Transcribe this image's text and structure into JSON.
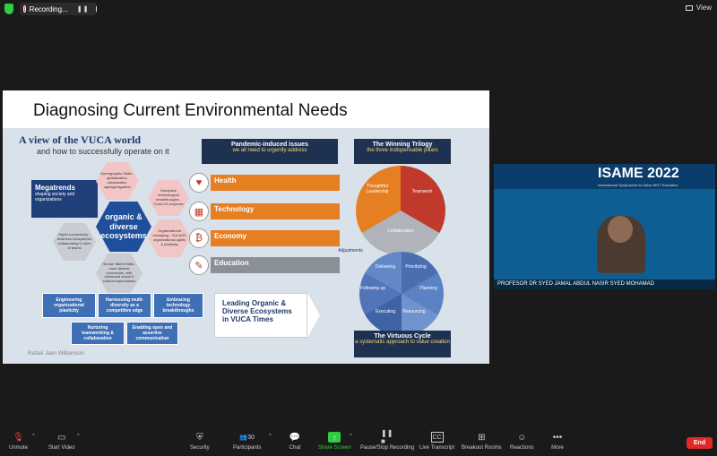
{
  "top_bar": {
    "recording_label": "Recording...",
    "view_label": "View"
  },
  "slide": {
    "title": "Diagnosing Current Environmental Needs",
    "vuca_title": "A view of the VUCA world",
    "vuca_sub": "and how to successfully operate on it",
    "megatrends_title": "Megatrends",
    "megatrends_sub": "shaping society and organizations",
    "center_hex": "organic & diverse ecosystems",
    "hexes": [
      "Demographic Shifts - globalization, urbanization, ageing/migration",
      "Disruptive technological breakthroughs - Covid-19 response",
      "Organizational reshaping - VUCA/SI organizational agility & plasticity",
      "Human Talent Skills - more diverse economies, with enhanced social & cultural expectations",
      "Hyper-connectivity - business ecosystems collaborating in roles of teams"
    ],
    "boxes": [
      "Engineering organizational plasticity",
      "Harnessing multi-diversity as a competitive edge",
      "Embracing technology breakthroughs",
      "Nurturing teamworking & collaboration",
      "Enabling open and assertive communication"
    ],
    "pandemic_title": "Pandemic-induced issues",
    "pandemic_sub": "we all need to urgently address",
    "items": [
      {
        "label": "Health",
        "icon": "heartbeat-icon",
        "glyph": "♥"
      },
      {
        "label": "Technology",
        "icon": "solar-panel-icon",
        "glyph": "▦"
      },
      {
        "label": "Economy",
        "icon": "bitcoin-icon",
        "glyph": "₿"
      },
      {
        "label": "Education",
        "icon": "teacher-icon",
        "glyph": "✎"
      }
    ],
    "leading_text": "Leading Organic & Diverse Ecosystems in VUCA Times",
    "trilogy_title": "The Winning Trilogy",
    "trilogy_sub": "the three indispensable pillars",
    "trilogy": [
      "Thoughtful Leadership",
      "Teamwork",
      "Collaboration"
    ],
    "cycle_title": "The Virtuous Cycle",
    "cycle_sub": "a systematic approach to value creation",
    "cycle": [
      "Delivering",
      "Prioritizing",
      "Planning",
      "Resourcing",
      "Executing",
      "Following up"
    ],
    "adjustments_label": "Adjustments",
    "author": "Rafael Jaen Williamson"
  },
  "video": {
    "banner_title": "ISAME 2022",
    "banner_sub": "International Symposium for Asian MOT Education",
    "participant_name": "PROFESOR DR SYED JAMAL ABDUL NASIR SYED MOHAMAD"
  },
  "toolbar": {
    "unmute": "Unmute",
    "start_video": "Start Video",
    "security": "Security",
    "participants": "Participants",
    "participants_count": "30",
    "chat": "Chat",
    "share_screen": "Share Screen",
    "pause_recording": "Pause/Stop Recording",
    "live_transcript": "Live Transcript",
    "breakout_rooms": "Breakout Rooms",
    "reactions": "Reactions",
    "more": "More",
    "end": "End"
  },
  "colors": {
    "share_green": "#2ecc40",
    "end_red": "#e02828",
    "slide_navy": "#1f3a6b",
    "issue_orange": "#e67e22"
  }
}
